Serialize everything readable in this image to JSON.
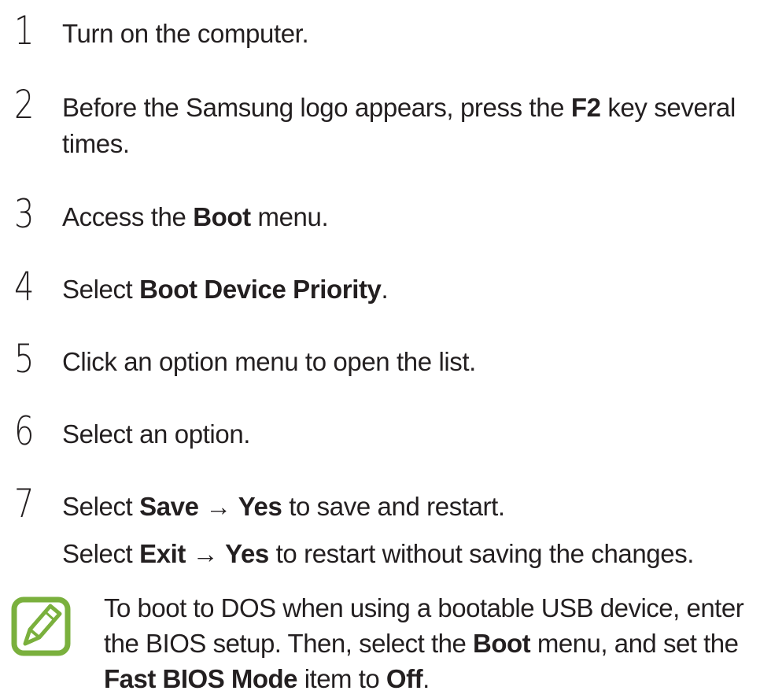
{
  "steps": [
    {
      "num": "1",
      "parts": [
        "Turn on the computer."
      ]
    },
    {
      "num": "2",
      "parts": [
        "Before the Samsung logo appears, press the ",
        "F2",
        " key several times."
      ]
    },
    {
      "num": "3",
      "parts": [
        "Access the ",
        "Boot",
        " menu."
      ]
    },
    {
      "num": "4",
      "parts": [
        "Select ",
        "Boot Device Priority",
        "."
      ]
    },
    {
      "num": "5",
      "parts": [
        "Click an option menu to open the list."
      ]
    },
    {
      "num": "6",
      "parts": [
        "Select an option."
      ]
    },
    {
      "num": "7",
      "parts": [
        "Select ",
        "Save",
        " → ",
        "Yes",
        " to save and restart."
      ]
    }
  ],
  "step7_sub": [
    "Select ",
    "Exit",
    " → ",
    "Yes",
    " to restart without saving the changes."
  ],
  "note": {
    "icon": "note-pencil-icon",
    "parts": [
      "To boot to DOS when using a bootable USB device, enter the BIOS setup. Then, select the ",
      "Boot",
      " menu, and set the ",
      "Fast BIOS Mode",
      " item to ",
      "Off",
      "."
    ]
  },
  "colors": {
    "text": "#231f20",
    "icon_green": "#7ab03d"
  }
}
